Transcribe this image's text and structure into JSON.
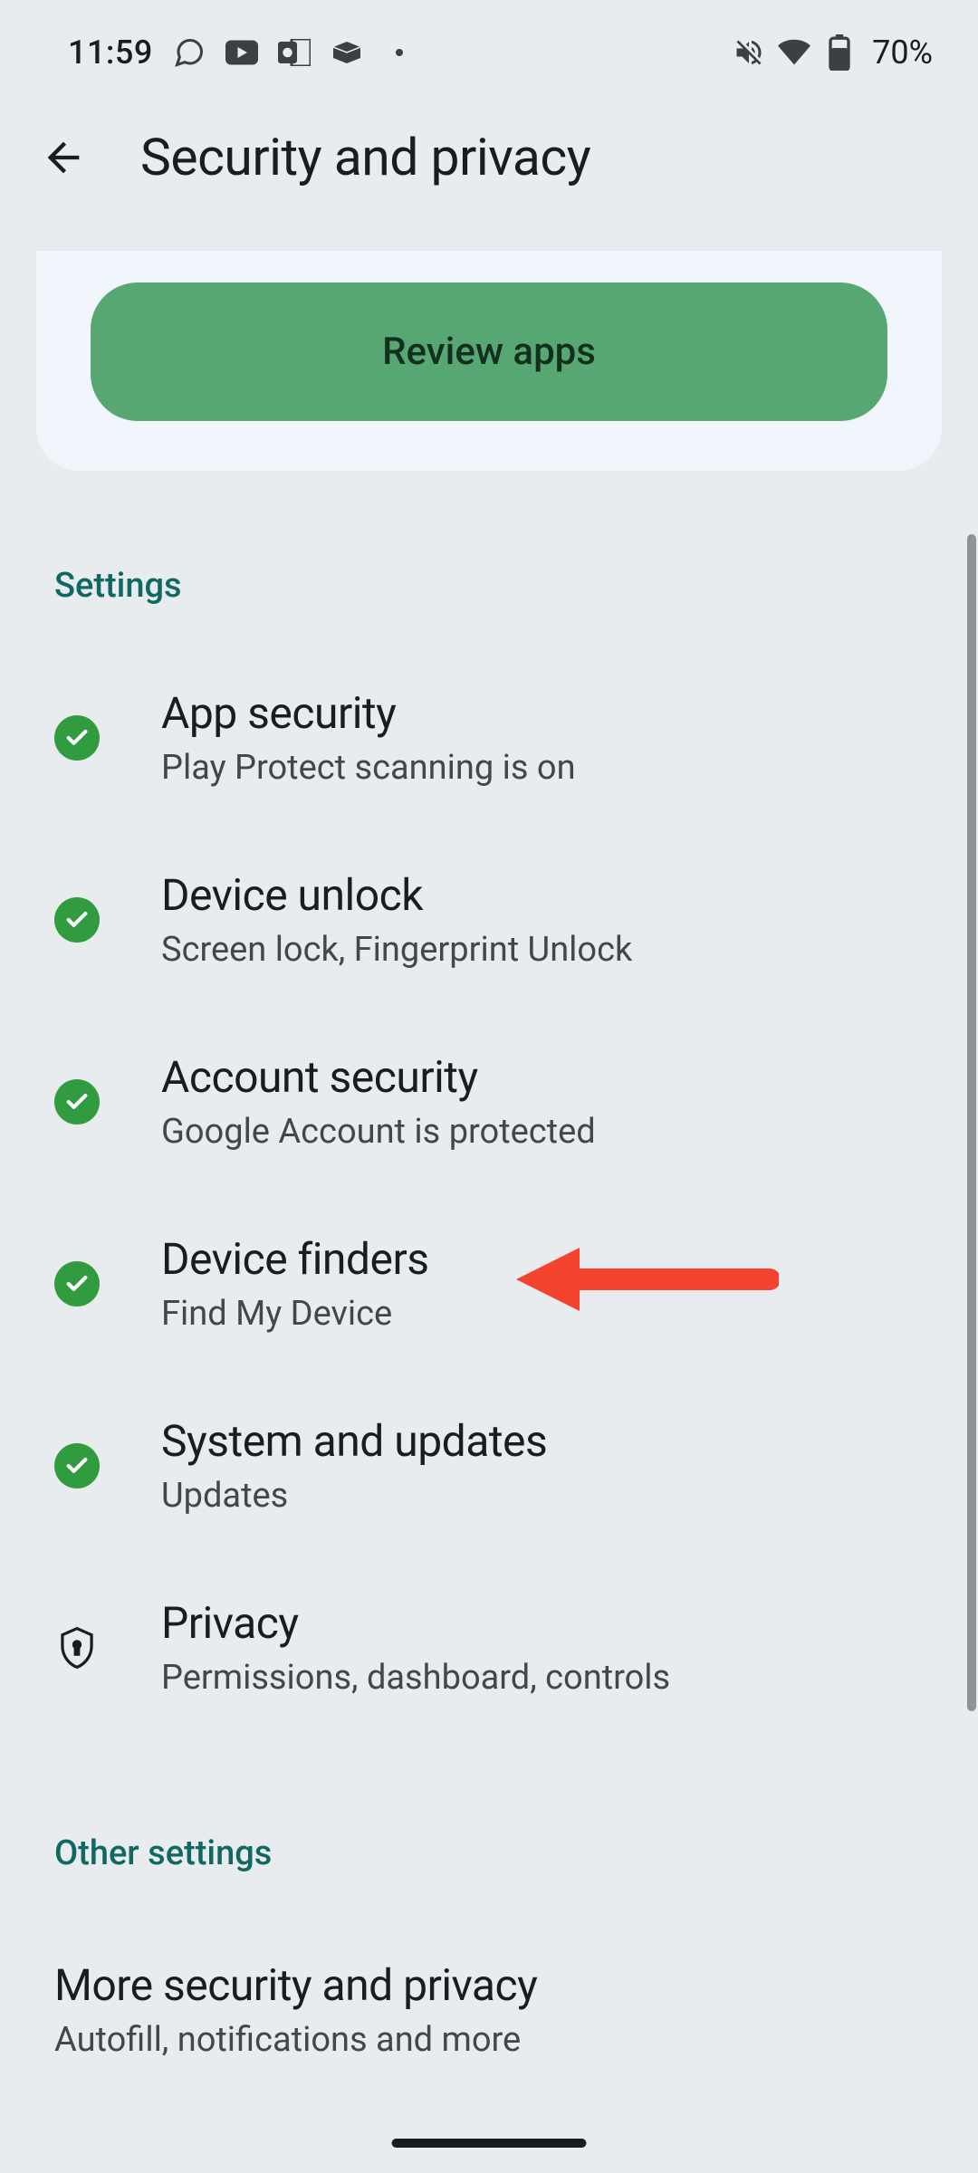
{
  "status_bar": {
    "time": "11:59",
    "battery_percent": "70%"
  },
  "header": {
    "title": "Security and privacy"
  },
  "review_card": {
    "button_label": "Review apps"
  },
  "sections": {
    "settings_label": "Settings",
    "other_label": "Other settings"
  },
  "settings_items": [
    {
      "title": "App security",
      "subtitle": "Play Protect scanning is on",
      "icon": "check"
    },
    {
      "title": "Device unlock",
      "subtitle": "Screen lock, Fingerprint Unlock",
      "icon": "check"
    },
    {
      "title": "Account security",
      "subtitle": "Google Account is protected",
      "icon": "check"
    },
    {
      "title": "Device finders",
      "subtitle": "Find My Device",
      "icon": "check"
    },
    {
      "title": "System and updates",
      "subtitle": "Updates",
      "icon": "check"
    },
    {
      "title": "Privacy",
      "subtitle": "Permissions, dashboard, controls",
      "icon": "shield"
    }
  ],
  "other_items": [
    {
      "title": "More security and privacy",
      "subtitle": "Autofill, notifications and more"
    }
  ]
}
